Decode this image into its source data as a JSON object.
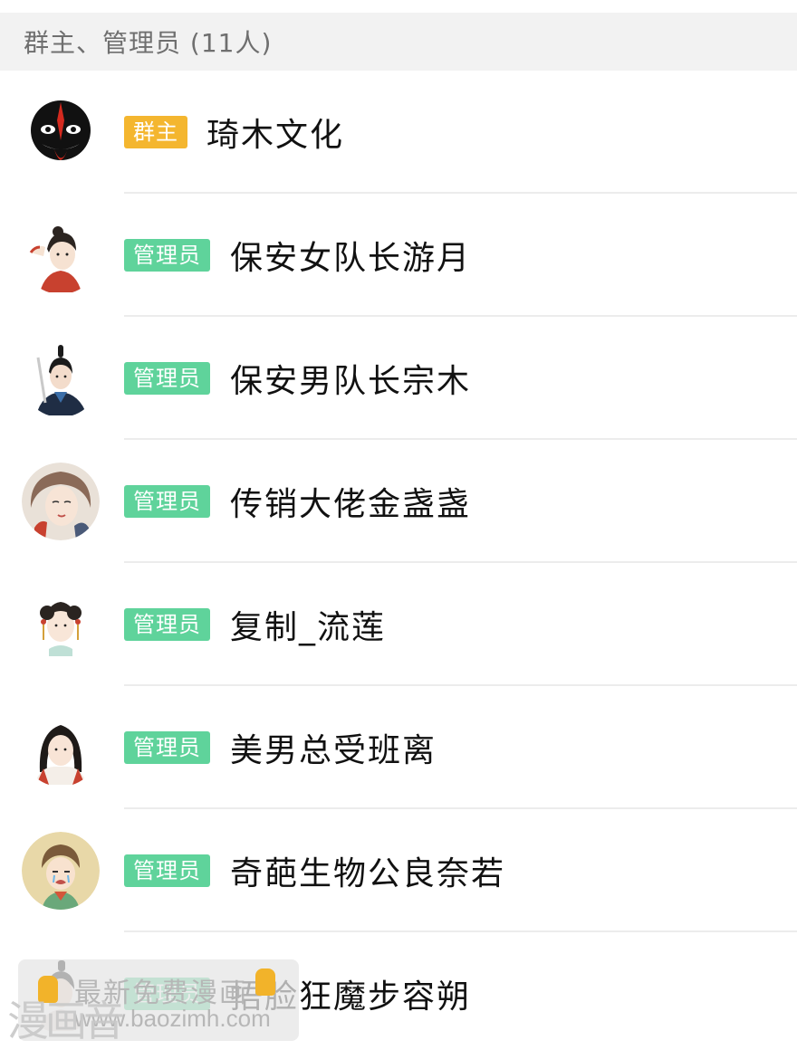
{
  "section": {
    "header": "群主、管理员 (11人)"
  },
  "members": [
    {
      "role": "群主",
      "role_type": "owner",
      "name": "琦木文化",
      "avatar_icon": "opera-mask-icon"
    },
    {
      "role": "管理员",
      "role_type": "admin",
      "name": "保安女队长游月",
      "avatar_icon": "female-guard-avatar-icon"
    },
    {
      "role": "管理员",
      "role_type": "admin",
      "name": "保安男队长宗木",
      "avatar_icon": "male-guard-avatar-icon"
    },
    {
      "role": "管理员",
      "role_type": "admin",
      "name": "传销大佬金盏盏",
      "avatar_icon": "lady-avatar-icon"
    },
    {
      "role": "管理员",
      "role_type": "admin",
      "name": "复制_流莲",
      "avatar_icon": "girl-avatar-icon"
    },
    {
      "role": "管理员",
      "role_type": "admin",
      "name": "美男总受班离",
      "avatar_icon": "man-avatar-icon"
    },
    {
      "role": "管理员",
      "role_type": "admin",
      "name": "奇葩生物公良奈若",
      "avatar_icon": "crying-avatar-icon"
    },
    {
      "role": "管理员",
      "role_type": "admin",
      "name": "捂脸狂魔步容朔",
      "avatar_icon": "scholar-avatar-icon"
    }
  ],
  "watermark": {
    "line1": "最新免费漫画",
    "line2": "www.baozimh.com",
    "logo": "漫画音"
  },
  "colors": {
    "owner_badge": "#f4b62f",
    "admin_badge": "#5fd39b",
    "header_bg": "#f2f2f2",
    "divider": "#ececec"
  }
}
